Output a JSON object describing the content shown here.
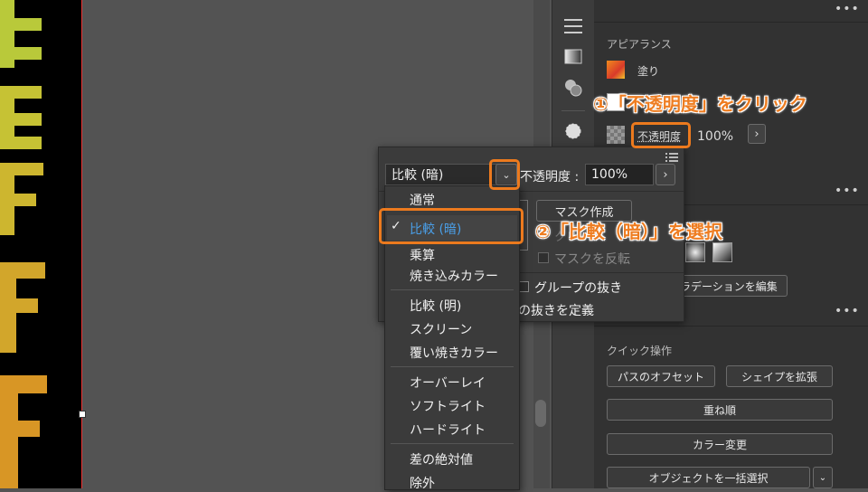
{
  "colors": {
    "accent_orange": "#ec7a1e",
    "selected_text": "#4a9fe8",
    "panel_bg": "#323232",
    "canvas_bg": "#535353"
  },
  "appearance": {
    "title": "アピアランス",
    "fill_label": "塗り",
    "opacity_label": "不透明度",
    "opacity_value": "100%",
    "more": "•••"
  },
  "popup": {
    "blend_mode_selected": "比較 (暗)",
    "opacity_label": "不透明度 :",
    "opacity_value": "100%",
    "mask_button": "マスク作成",
    "clip_label": "クリ",
    "invert_mask": "マスクを反転",
    "knockout_group": "グループの抜き",
    "define_knockout": "の抜きを定義"
  },
  "dropdown": {
    "items": [
      "通常",
      "比較 (暗)",
      "乗算",
      "焼き込みカラー",
      "比較 (明)",
      "スクリーン",
      "覆い焼きカラー",
      "オーバーレイ",
      "ソフトライト",
      "ハードライト",
      "差の絶対値",
      "除外"
    ],
    "checkmark": "✓"
  },
  "gradient": {
    "edit_button": "ラデーションを編集"
  },
  "quick_actions": {
    "title": "クイック操作",
    "offset_path": "パスのオフセット",
    "expand_shape": "シェイプを拡張",
    "arrange": "重ね順",
    "recolor": "カラー変更",
    "select_same": "オブジェクトを一括選択"
  },
  "annotations": {
    "step1": "①「不透明度」をクリック",
    "step2": "②「比較（暗）」を選択"
  },
  "icons": [
    "hamburger-icon",
    "gradient-icon",
    "shapes-icon",
    "circle-dotted-icon",
    "chevron-down-icon",
    "chevron-right-icon",
    "checkmark-icon",
    "list-icon"
  ]
}
